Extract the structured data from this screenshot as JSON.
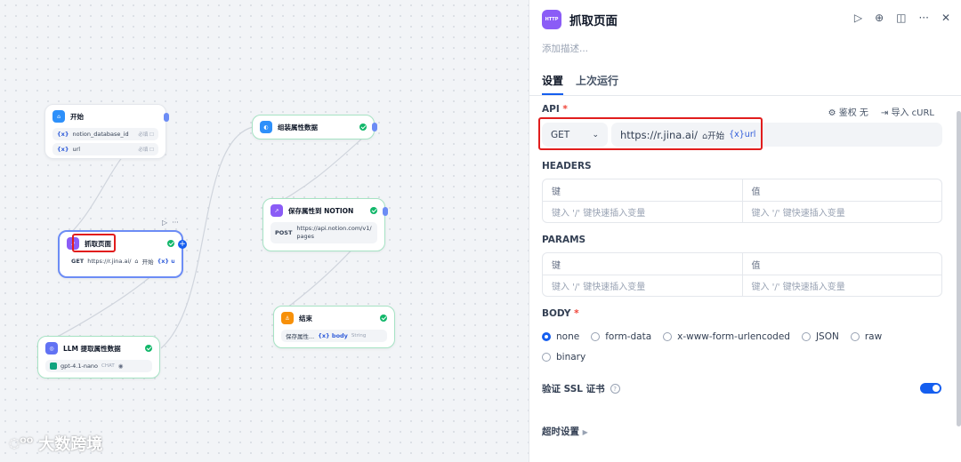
{
  "canvas": {
    "start_node": {
      "title": "开始",
      "vars": [
        {
          "name": "notion_database_id",
          "tag": "必填 ☐"
        },
        {
          "name": "url",
          "tag": "必填 ☐"
        }
      ]
    },
    "fetch_node": {
      "title": "抓取页面",
      "method": "GET",
      "url": "https://r.jina.ai/",
      "start_label": "开始",
      "var": "{x} url"
    },
    "llm_node": {
      "title": "LLM 提取属性数据",
      "model": "gpt-4.1-nano",
      "model_tag": "CHAT"
    },
    "assemble_node": {
      "title": "组装属性数据"
    },
    "notion_node": {
      "title": "保存属性到 NOTION",
      "method": "POST",
      "url": "https://api.notion.com/v1/pages"
    },
    "end_node": {
      "title": "结束",
      "var_source": "保存属性...",
      "var": "{x} body",
      "type": "String"
    }
  },
  "panel": {
    "icon_text": "HTTP",
    "title": "抓取页面",
    "description_placeholder": "添加描述...",
    "tabs": [
      "设置",
      "上次运行"
    ],
    "api": {
      "label": "API",
      "required_mark": "*",
      "auth": "⚙ 鉴权 无",
      "import": "⇥ 导入 cURL",
      "method": "GET",
      "url": "https://r.jina.ai/",
      "start_chip": "⌂开始",
      "var_chip": "{x}url"
    },
    "headers": {
      "label": "HEADERS",
      "key_col": "键",
      "value_col": "值",
      "key_placeholder": "键入 '/' 键快速插入变量",
      "value_placeholder": "键入 '/' 键快速插入变量"
    },
    "params": {
      "label": "PARAMS",
      "key_col": "键",
      "value_col": "值",
      "key_placeholder": "键入 '/' 键快速插入变量",
      "value_placeholder": "键入 '/' 键快速插入变量"
    },
    "body": {
      "label": "BODY",
      "required_mark": "*",
      "options": [
        "none",
        "form-data",
        "x-www-form-urlencoded",
        "JSON",
        "raw",
        "binary"
      ],
      "selected": "none"
    },
    "ssl": {
      "label": "验证 SSL 证书",
      "enabled": true
    },
    "timeout": {
      "label": "超时设置"
    }
  },
  "watermark": "大数跨境",
  "colors": {
    "accent": "#155eef",
    "highlight": "#e11d1d",
    "success": "#12b76a"
  }
}
